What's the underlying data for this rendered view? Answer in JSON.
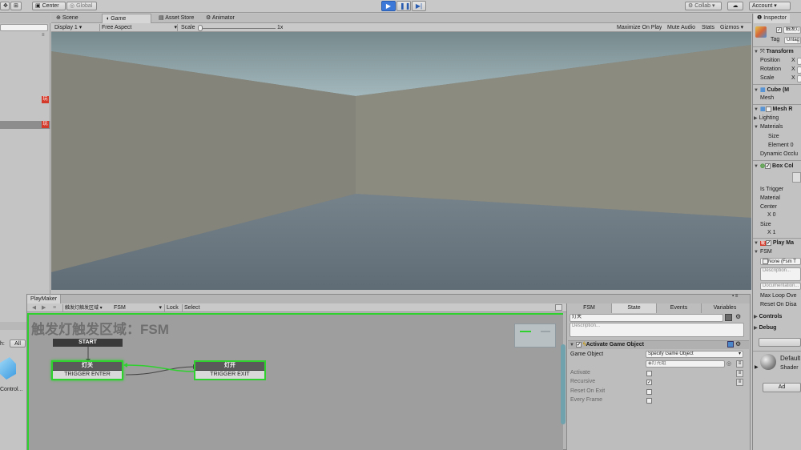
{
  "toolbar": {
    "pivot": "Center",
    "space": "Global",
    "collab": "Collab",
    "account": "Account"
  },
  "tabs": {
    "scene": "Scene",
    "game": "Game",
    "asset_store": "Asset Store",
    "animator": "Animator",
    "inspector": "Inspector"
  },
  "game_bar": {
    "display": "Display 1",
    "aspect": "Free Aspect",
    "scale_label": "Scale",
    "scale_value": "1x",
    "maximize": "Maximize On Play",
    "mute": "Mute Audio",
    "stats": "Stats",
    "gizmos": "Gizmos"
  },
  "left": {
    "badge": "玩",
    "project_prefix": "h:",
    "all": "All",
    "asset_label": "Control..."
  },
  "playmaker": {
    "title": "PlayMaker",
    "go_name": "触发灯触发区域",
    "fsm_select": "FSM",
    "lock": "Lock",
    "select": "Select",
    "fsm_heading": "触发灯触发区域：FSM",
    "states": {
      "start": "START",
      "a_title": "灯关",
      "a_event": "TRIGGER ENTER",
      "b_title": "灯开",
      "b_event": "TRIGGER EXIT"
    },
    "tabs": {
      "fsm": "FSM",
      "state": "State",
      "events": "Events",
      "variables": "Variables"
    },
    "state_name": "灯关",
    "description_ph": "Description...",
    "action": {
      "title": "Activate Game Object",
      "game_object": "Game Object",
      "specify": "Specify Game Object",
      "target": "灯光组",
      "rows": [
        {
          "label": "Activate",
          "checked": ""
        },
        {
          "label": "Recursive",
          "checked": "✓"
        },
        {
          "label": "Reset On Exit",
          "checked": ""
        },
        {
          "label": "Every Frame",
          "checked": ""
        }
      ]
    }
  },
  "inspector": {
    "obj_name": "触发灯",
    "tag_label": "Tag",
    "tag_val": "Untag",
    "transform": "Transform",
    "position": "Position",
    "rotation": "Rotation",
    "scale": "Scale",
    "x": "X",
    "cube": "Cube (M",
    "mesh": "Mesh",
    "mesh_renderer": "Mesh R",
    "lighting": "Lighting",
    "materials": "Materials",
    "size": "Size",
    "element": "Element 0",
    "dynamic": "Dynamic Occlu",
    "box_collider": "Box Col",
    "is_trigger": "Is Trigger",
    "material": "Material",
    "center": "Center",
    "center_x": "X 0",
    "size_label": "Size",
    "size_x": "X 1",
    "playmaker_comp": "Play Ma",
    "fsm": "FSM",
    "fsm_field": "None (Fsm T",
    "desc_ph": "Description...",
    "doc_ph": "Documentation...",
    "max_loop": "Max Loop Ove",
    "reset_disable": "Reset On Disa",
    "controls": "Controls",
    "debug": "Debug",
    "default_mat": "Default",
    "shader": "Shader",
    "add": "Ad"
  }
}
